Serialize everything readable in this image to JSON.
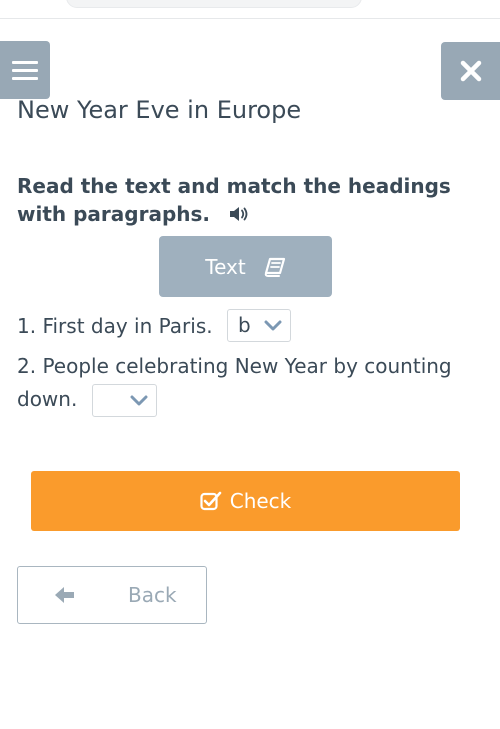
{
  "header": {
    "menu_icon": "hamburger-menu-icon",
    "close_icon": "close-x-icon"
  },
  "page": {
    "title": "New Year Eve in Europe"
  },
  "task": {
    "instructions": "Read the text and match the headings with paragraphs.",
    "audio_icon": "speaker-icon",
    "text_button_label": "Text",
    "text_button_icon": "book-icon"
  },
  "questions": [
    {
      "prompt": "1. First day in Paris.",
      "selected": "b"
    },
    {
      "prompt": "2. People celebrating New Year by counting down.",
      "selected": ""
    }
  ],
  "actions": {
    "check_label": "Check",
    "check_icon": "checkbox-icon",
    "back_label": "Back",
    "back_icon": "arrow-left-icon"
  },
  "colors": {
    "header_button": "#98a8b5",
    "text_button": "#9fb0be",
    "check_button": "#fa9b2c",
    "text": "#3b4a57"
  }
}
